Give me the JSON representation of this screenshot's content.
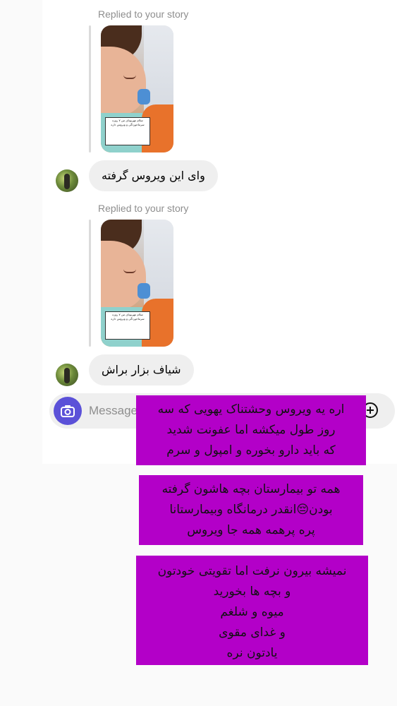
{
  "thread": {
    "messages": [
      {
        "replied_label": "Replied to your story",
        "story_caption": "سلام مهربونای من ۷ روزه سرماخوردگی و ویروس داره",
        "text": "وای این ویروس گرفته"
      },
      {
        "replied_label": "Replied to your story",
        "story_caption": "سلام مهربونای من ۷ روزه سرماخوردگی و ویروس داره",
        "text": "شیاف بزار براش"
      }
    ]
  },
  "composer": {
    "placeholder": "Message",
    "camera_icon": "camera-icon",
    "add_icon": "plus-circle-icon"
  },
  "overlay_notes": [
    {
      "lines": [
        "اره یه ویروس وحشتناک یهویی که سه",
        "روز طول میکشه اما عفونت شدید",
        "که باید دارو بخوره و امپول و سرم"
      ]
    },
    {
      "lines": [
        "همه تو بیمارستان بچه هاشون گرفته",
        "بودن😔انقدر درمانگاه وبیمارستانا",
        "پره پرهمه همه جا ویروس"
      ]
    },
    {
      "lines": [
        "نمیشه بیرون نرفت اما تقویتی خودتون",
        "و بچه ها بخورید",
        "میوه و شلغم",
        "و غدای مقوی",
        "یادتون نره"
      ]
    }
  ],
  "colors": {
    "note_background": "#b300c8",
    "bubble_background": "#efefef",
    "camera_button": "#5b51d8"
  }
}
